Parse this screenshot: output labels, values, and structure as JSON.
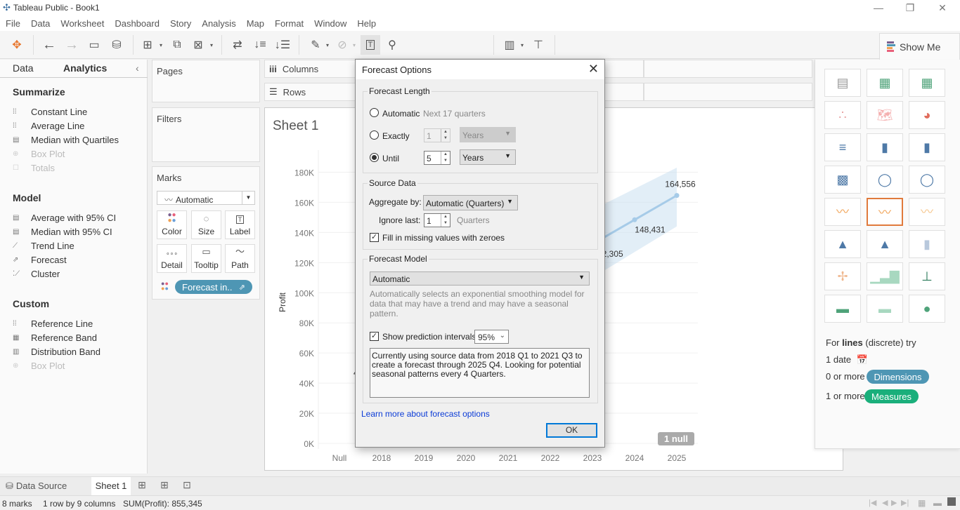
{
  "window": {
    "title": "Tableau Public - Book1",
    "minimize": "—",
    "restore": "❐",
    "close": "✕"
  },
  "menu": [
    "File",
    "Data",
    "Worksheet",
    "Dashboard",
    "Story",
    "Analysis",
    "Map",
    "Format",
    "Window",
    "Help"
  ],
  "toolbar": {
    "fit_select": "Standard",
    "show_me": "Show Me"
  },
  "left_pane": {
    "tabs": {
      "data": "Data",
      "analytics": "Analytics"
    },
    "summarize": {
      "title": "Summarize",
      "items": [
        {
          "label": "Constant Line",
          "enabled": true
        },
        {
          "label": "Average Line",
          "enabled": true
        },
        {
          "label": "Median with Quartiles",
          "enabled": true
        },
        {
          "label": "Box Plot",
          "enabled": false
        },
        {
          "label": "Totals",
          "enabled": false
        }
      ]
    },
    "model": {
      "title": "Model",
      "items": [
        {
          "label": "Average with 95% CI",
          "enabled": true
        },
        {
          "label": "Median with 95% CI",
          "enabled": true
        },
        {
          "label": "Trend Line",
          "enabled": true
        },
        {
          "label": "Forecast",
          "enabled": true
        },
        {
          "label": "Cluster",
          "enabled": true
        }
      ]
    },
    "custom": {
      "title": "Custom",
      "items": [
        {
          "label": "Reference Line",
          "enabled": true
        },
        {
          "label": "Reference Band",
          "enabled": true
        },
        {
          "label": "Distribution Band",
          "enabled": true
        },
        {
          "label": "Box Plot",
          "enabled": false
        }
      ]
    }
  },
  "cards": {
    "pages": "Pages",
    "filters": "Filters",
    "marks": "Marks",
    "mark_type": "Automatic",
    "buttons": [
      "Color",
      "Size",
      "Label",
      "Detail",
      "Tooltip",
      "Path"
    ],
    "pill": "Forecast in.."
  },
  "shelves": {
    "columns": "Columns",
    "rows": "Rows"
  },
  "sheet": {
    "title": "Sheet 1",
    "null_badge": "1 null"
  },
  "chart_data": {
    "type": "line",
    "title": "Sheet 1",
    "xlabel": "",
    "ylabel": "Profit",
    "x": [
      "Null",
      "2018",
      "2019",
      "2020",
      "2021",
      "2022",
      "2023",
      "2024",
      "2025"
    ],
    "y_ticks": [
      "0K",
      "20K",
      "40K",
      "60K",
      "80K",
      "100K",
      "120K",
      "140K",
      "160K",
      "180K"
    ],
    "ylim": [
      0,
      190000
    ],
    "visible_series": {
      "name": "Forecast",
      "points": [
        {
          "x": "2023",
          "y": 132305,
          "label": "132,305"
        },
        {
          "x": "2024",
          "y": 148431,
          "label": "148,431"
        },
        {
          "x": "2025",
          "y": 164556,
          "label": "164,556"
        }
      ]
    },
    "prediction_interval": {
      "level": "95%",
      "upper": [
        {
          "x": "2023",
          "y": 155000
        },
        {
          "x": "2025",
          "y": 183000
        }
      ],
      "lower": [
        {
          "x": "2023",
          "y": 110000
        },
        {
          "x": "2025",
          "y": 144000
        }
      ]
    },
    "partial_label": "4",
    "grid": true
  },
  "dialog": {
    "title": "Forecast Options",
    "forecast_length": {
      "title": "Forecast Length",
      "automatic": "Automatic",
      "automatic_hint": "Next 17 quarters",
      "exactly": "Exactly",
      "exactly_value": "1",
      "exactly_unit": "Years",
      "until": "Until",
      "until_value": "5",
      "until_unit": "Years",
      "selected": "until"
    },
    "source_data": {
      "title": "Source Data",
      "aggregate_label": "Aggregate by:",
      "aggregate_value": "Automatic (Quarters)",
      "ignore_label": "Ignore last:",
      "ignore_value": "1",
      "ignore_unit": "Quarters",
      "fill_missing": "Fill in missing values with zeroes",
      "fill_checked": true
    },
    "forecast_model": {
      "title": "Forecast Model",
      "value": "Automatic",
      "description": "Automatically selects an exponential smoothing model for data that may have a trend and may have a seasonal pattern.",
      "show_intervals": "Show prediction intervals",
      "intervals_checked": true,
      "interval_value": "95%",
      "summary": "Currently using source data from 2018 Q1 to 2021 Q3 to create a forecast through 2025 Q4. Looking for potential seasonal patterns every 4 Quarters."
    },
    "learn_more": "Learn more about forecast options",
    "ok": "OK"
  },
  "show_me": {
    "hint_prefix": "For ",
    "hint_bold": "lines",
    "hint_suffix": " (discrete) try",
    "req_date": "1 date",
    "req_dims_prefix": "0 or more",
    "req_dims": "Dimensions",
    "req_meas_prefix": "1 or more",
    "req_meas": "Measures",
    "dims_color": "#4e96b4",
    "meas_color": "#1aaf7b",
    "selected_color": "#e07a3c"
  },
  "bottom": {
    "data_source": "Data Source",
    "sheet_tab": "Sheet 1"
  },
  "status": {
    "marks": "8 marks",
    "dims": "1 row by 9 columns",
    "sum": "SUM(Profit): 855,345"
  }
}
